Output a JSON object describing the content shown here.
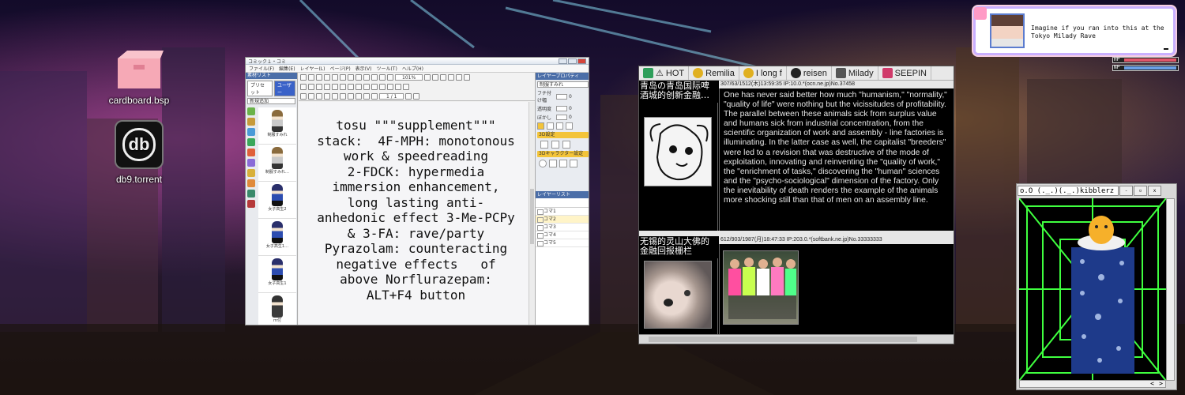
{
  "desktop": {
    "icons": [
      {
        "label": "cardboard.bsp",
        "icon": "box-icon"
      },
      {
        "label": "db9.torrent",
        "icon": "db-logo-icon",
        "glyph_text": "db"
      }
    ]
  },
  "comic_app": {
    "title": "コミック１・コミ",
    "menu": [
      "ファイル(F)",
      "編集(E)",
      "レイヤー(L)",
      "ページ(P)",
      "表示(V)",
      "ツール(T)",
      "ヘルプ(H)"
    ],
    "left_panel": {
      "header": "素材リスト",
      "tabs": [
        "プリセット",
        "ユーザー"
      ],
      "category": "新規追加",
      "thumbs": [
        "制服すみれ",
        "制服すみれ…",
        "女子高生2",
        "女子高生1…",
        "女子高生1",
        "ｍ付",
        ""
      ]
    },
    "toolbar": {
      "zoom": "101%",
      "page": "1 / 1"
    },
    "canvas_text": "tosu \"\"\"supplement\"\"\"\nstack:  4F-MPH: monotonous\nwork & speedreading\n2-FDCK: hypermedia\nimmersion enhancement,\nlong lasting anti-\nanhedonic effect 3-Me-PCPy\n& 3-FA: rave/party\nPyrazolam: counteracting\nnegative effects   of\nabove Norflurazepam:\nALT+F4 button",
    "right_panel": {
      "header": "レイヤープロパティ",
      "name_field": "制服すみれ",
      "rows": [
        {
          "label": "フチ付け幅",
          "value": "0"
        },
        {
          "label": "透明度",
          "value": "0"
        },
        {
          "label": "ぼかし",
          "value": "0"
        }
      ],
      "section_3d": "3D設定",
      "section_char": "3Dキャラクター設定",
      "layer_list_header": "レイヤーリスト",
      "layers": [
        "コマ1",
        "コマ2",
        "コマ3",
        "コマ4",
        "コマ5"
      ],
      "selected_layer": "コマ2"
    }
  },
  "forum": {
    "tabs": [
      {
        "label": "⚠ HOT",
        "color": "#2e9e5a"
      },
      {
        "label": "Remilia",
        "color": "#e0b020"
      },
      {
        "label": "I long f",
        "color": "#e0b020"
      },
      {
        "label": "reisen",
        "color": "#222222"
      },
      {
        "label": "Milady",
        "color": "#555555"
      },
      {
        "label": "SEEPIN",
        "color": "#d03a6a"
      }
    ],
    "posts": [
      {
        "title": "青岛の青岛国际啤酒城的创新金融…",
        "meta": "307/63/1512(木)13:59:35 IP:10.0.*(ocn.ne.jp)No.37458",
        "body": "One has never said better how much \"humanism,\" \"normality,\" \"quality of life\" were nothing but the vicissitudes of profitability. The parallel between these animals sick from surplus value and humans sick from industrial concentration, from the scientific organization of work and assembly - line factories is illuminating. In the latter case as well, the capitalist \"breeders\" were led to a revision that was destructive of the mode of exploitation, innovating and reinventing the \"quality of work,\" the \"enrichment of tasks,\" discovering the \"human\" sciences and the \"psycho-sociological\" dimension of the factory. Only the inevitability of death renders the example of the animals more shocking still than that of men on an assembly line."
      },
      {
        "title": "无锡的灵山大佛的金融回报栅栏",
        "meta": "612/903/1987(月)18:47:33 IP:203.0.*(softbank.ne.jp)No.33333333",
        "body": ""
      }
    ]
  },
  "game": {
    "title": "o.O (._.)(._.)kibblerz :kibblerz:",
    "buttons": [
      "-",
      "▫",
      "x"
    ],
    "scroll_left": "<",
    "scroll_right": ">"
  },
  "chat": {
    "message": "Imagine if you ran into this at the Tokyo Milady Rave"
  },
  "stats": {
    "hp_label": "HP",
    "np_label": "NP",
    "hp_value": 1.0,
    "np_value": 1.0,
    "hp_color": "#e0566a",
    "np_color": "#6aa0e6"
  },
  "colors": {
    "comic_accent": "#4b6ea8",
    "forum_bg": "#000000",
    "chat_border": "#c9b0ff"
  }
}
